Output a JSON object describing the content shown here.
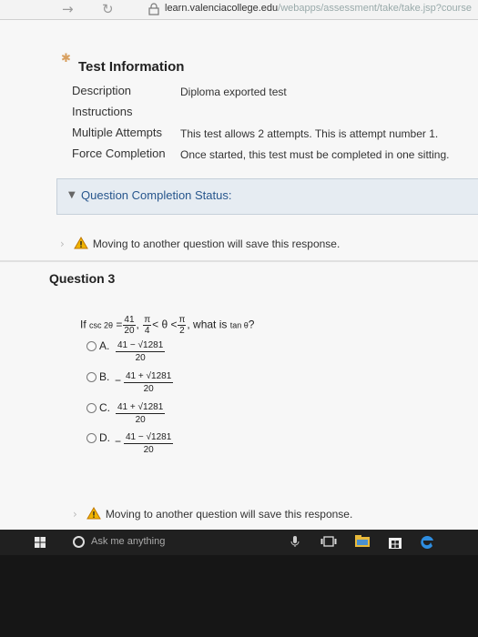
{
  "browser": {
    "url_domain": "learn.valenciacollege.edu",
    "url_path": "/webapps/assessment/take/take.jsp?course"
  },
  "test_info": {
    "title": "Test Information",
    "rows": [
      {
        "label": "Description",
        "value": "Diploma exported test"
      },
      {
        "label": "Instructions",
        "value": ""
      },
      {
        "label": "Multiple Attempts",
        "value": "This test allows 2 attempts. This is attempt number 1."
      },
      {
        "label": "Force Completion",
        "value": "Once started, this test must be completed in one sitting."
      }
    ]
  },
  "status": {
    "label": "Question Completion Status:"
  },
  "save_notice": "Moving to another question will save this response.",
  "question": {
    "title": "Question 3",
    "prefix": "If",
    "func": "csc 2θ",
    "eq": "=",
    "frac1_num": "41",
    "frac1_den": "20",
    "comma": ",",
    "frac2_num": "π",
    "frac2_den": "4",
    "lt": "< θ <",
    "frac3_num": "π",
    "frac3_den": "2",
    "suffix": ", what is",
    "ask_fn": "tan θ",
    "qmark": "?",
    "choices": [
      {
        "letter": "A.",
        "sign": "",
        "num": "41 − √1281",
        "den": "20"
      },
      {
        "letter": "B.",
        "sign": "−",
        "num": "41 + √1281",
        "den": "20"
      },
      {
        "letter": "C.",
        "sign": "",
        "num": "41 + √1281",
        "den": "20"
      },
      {
        "letter": "D.",
        "sign": "−",
        "num": "41 − √1281",
        "den": "20"
      }
    ]
  },
  "taskbar": {
    "search_placeholder": "Ask me anything"
  },
  "colors": {
    "accent_link": "#27568d",
    "warning": "#f0b400",
    "status_bg": "#e6ecf2"
  }
}
